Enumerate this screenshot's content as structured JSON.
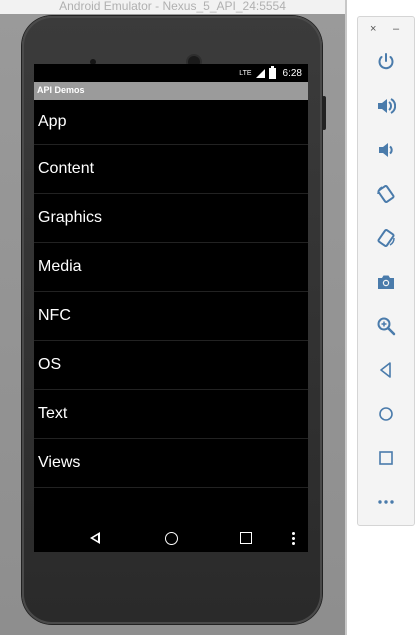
{
  "window": {
    "title": "Android Emulator - Nexus_5_API_24:5554"
  },
  "status_bar": {
    "network": "LTE",
    "time": "6:28"
  },
  "app": {
    "title": "API Demos",
    "items": [
      {
        "label": "App"
      },
      {
        "label": "Content"
      },
      {
        "label": "Graphics"
      },
      {
        "label": "Media"
      },
      {
        "label": "NFC"
      },
      {
        "label": "OS"
      },
      {
        "label": "Text"
      },
      {
        "label": "Views"
      }
    ]
  },
  "nav_bar": {
    "icons": [
      "back-icon",
      "home-icon",
      "recents-icon",
      "overflow-menu-icon"
    ]
  },
  "toolbar": {
    "close_glyph": "×",
    "minimize_glyph": "–",
    "icons": [
      "power-icon",
      "volume-up-icon",
      "volume-down-icon",
      "rotate-left-icon",
      "rotate-right-icon",
      "camera-icon",
      "zoom-icon",
      "back-icon",
      "home-icon",
      "overview-icon",
      "more-icon"
    ]
  },
  "colors": {
    "accent": "#4a7bab",
    "action_bar": "#9b9b9b",
    "screen_bg": "#000000"
  }
}
